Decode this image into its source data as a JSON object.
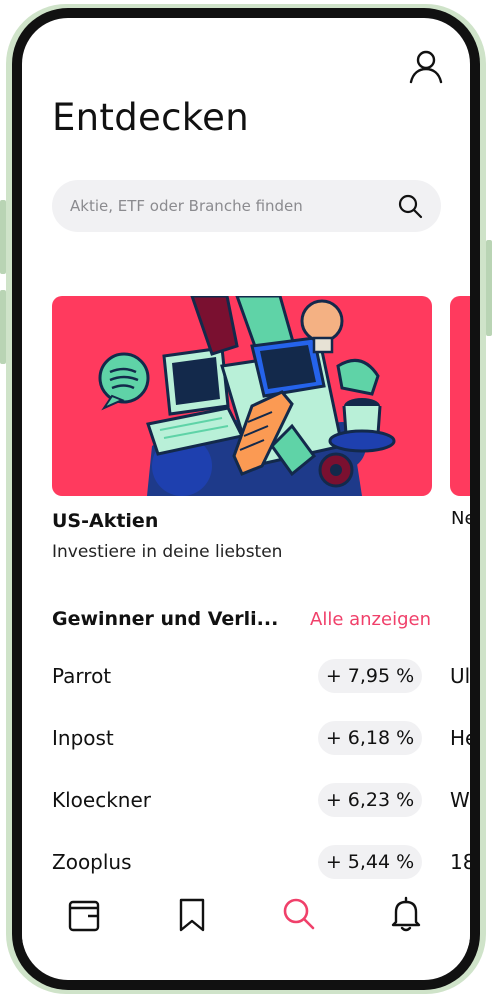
{
  "header": {
    "title": "Entdecken",
    "profile_icon": "user-icon"
  },
  "search": {
    "placeholder": "Aktie, ETF oder Branche finden",
    "icon": "search-icon"
  },
  "featured": [
    {
      "title": "US-Aktien",
      "subtitle": "Investiere in deine liebsten",
      "accent": "#ff3a5e"
    },
    {
      "title": "Ne"
    }
  ],
  "movers": {
    "title": "Gewinner und Verli...",
    "show_all_label": "Alle anzeigen",
    "show_all_color": "#f0406a",
    "rows": [
      {
        "name": "Parrot",
        "change": "+ 7,95 %",
        "peek": "Ul"
      },
      {
        "name": "Inpost",
        "change": "+ 6,18 %",
        "peek": "He"
      },
      {
        "name": "Kloeckner",
        "change": "+ 6,23 %",
        "peek": "W"
      },
      {
        "name": "Zooplus",
        "change": "+ 5,44 %",
        "peek": "18"
      }
    ]
  },
  "tabbar": {
    "active_color": "#f0406a",
    "tabs": [
      {
        "icon": "wallet-icon",
        "active": false
      },
      {
        "icon": "bookmark-icon",
        "active": false
      },
      {
        "icon": "search-icon",
        "active": true
      },
      {
        "icon": "bell-icon",
        "active": false
      }
    ]
  }
}
